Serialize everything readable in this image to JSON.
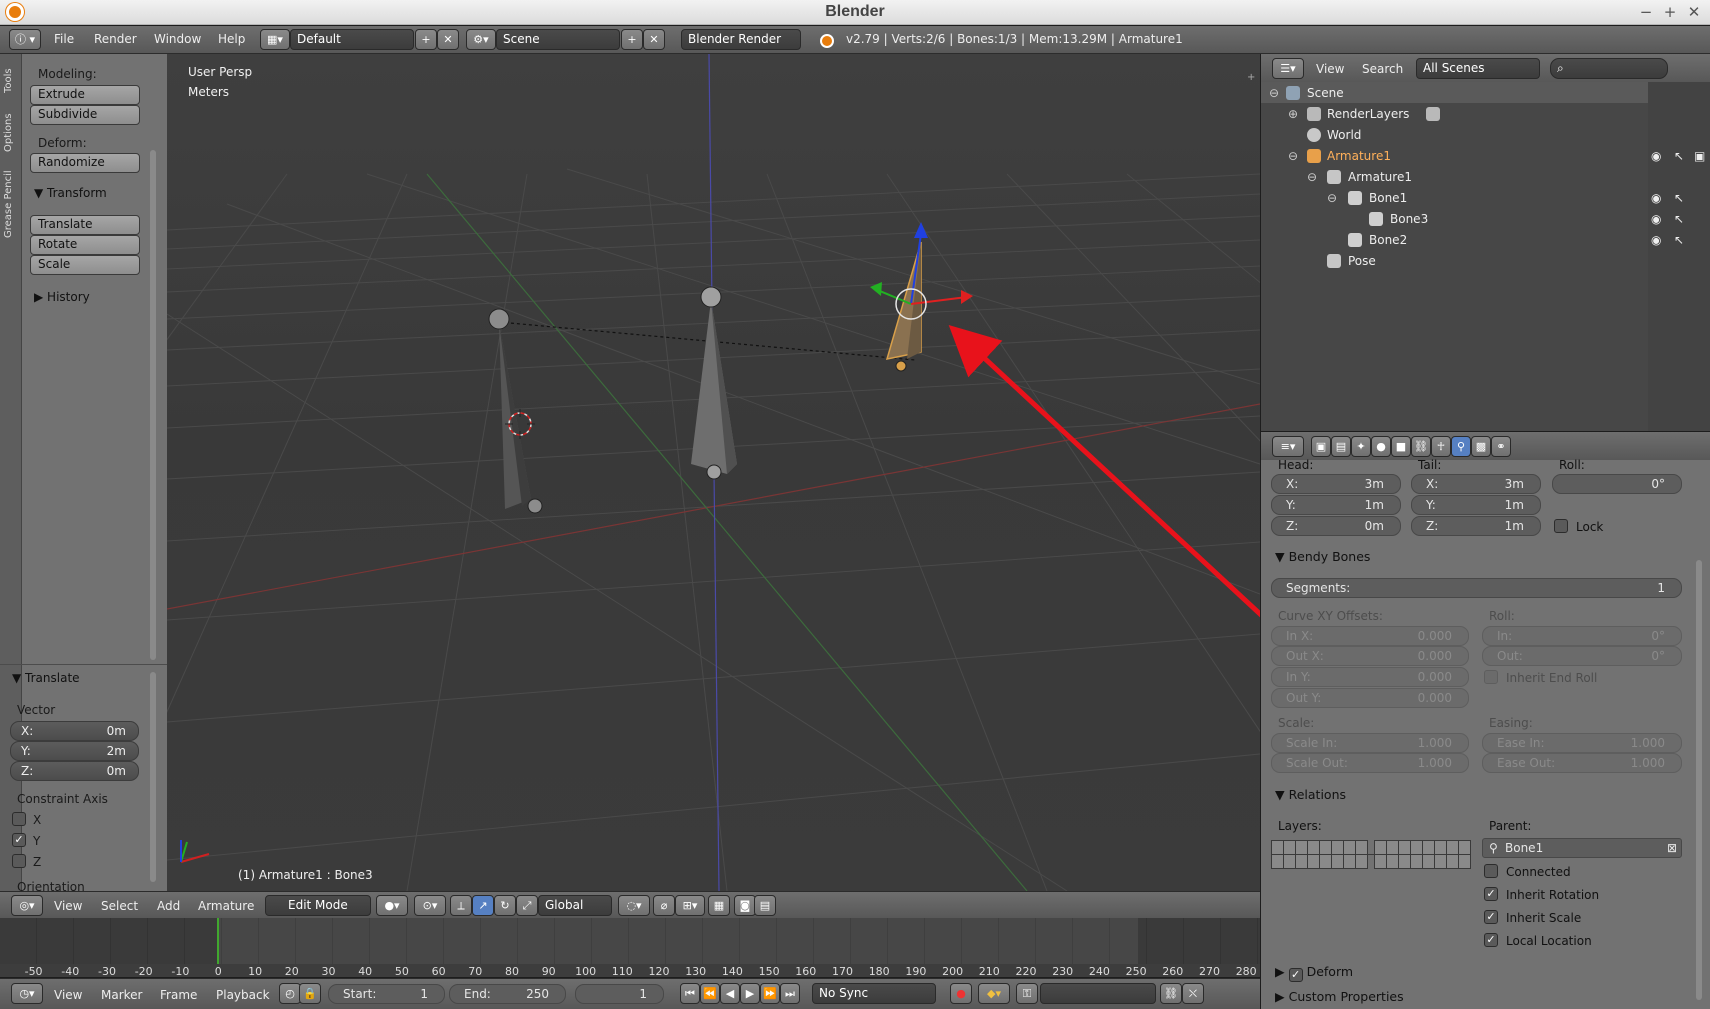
{
  "window": {
    "title": "Blender"
  },
  "menubar": {
    "menus": [
      "File",
      "Render",
      "Window",
      "Help"
    ],
    "layout": "Default",
    "scene": "Scene",
    "engine": "Blender Render",
    "stats": "v2.79 | Verts:2/6 | Bones:1/3 | Mem:13.29M | Armature1"
  },
  "tool_shelf": {
    "tabs": [
      "Tools",
      "Options",
      "Grease Pencil"
    ],
    "modeling_label": "Modeling:",
    "modeling_buttons": [
      "Extrude",
      "Subdivide"
    ],
    "deform_label": "Deform:",
    "deform_buttons": [
      "Randomize"
    ],
    "transform_header": "Transform",
    "transform_buttons": [
      "Translate",
      "Rotate",
      "Scale"
    ],
    "history_header": "History"
  },
  "operator_panel": {
    "header": "Translate",
    "vector_label": "Vector",
    "x_label": "X:",
    "x_value": "0m",
    "y_label": "Y:",
    "y_value": "2m",
    "z_label": "Z:",
    "z_value": "0m",
    "constraint_label": "Constraint Axis",
    "axes": [
      {
        "label": "X",
        "checked": false
      },
      {
        "label": "Y",
        "checked": true
      },
      {
        "label": "Z",
        "checked": false
      }
    ],
    "orientation_label": "Orientation"
  },
  "viewport": {
    "view_name": "User Persp",
    "units": "Meters",
    "status": "(1) Armature1 : Bone3"
  },
  "outliner": {
    "view_menu": "View",
    "search_menu": "Search",
    "filter": "All Scenes",
    "items": [
      "Scene",
      "RenderLayers",
      "World",
      "Armature1",
      "Armature1",
      "Bone1",
      "Bone3",
      "Bone2",
      "Pose"
    ]
  },
  "properties": {
    "head_label": "Head:",
    "tail_label": "Tail:",
    "roll_label": "Roll:",
    "head": {
      "x_label": "X:",
      "x": "3m",
      "y_label": "Y:",
      "y": "1m",
      "z_label": "Z:",
      "z": "0m"
    },
    "tail": {
      "x_label": "X:",
      "x": "3m",
      "y_label": "Y:",
      "y": "1m",
      "z_label": "Z:",
      "z": "1m"
    },
    "roll_value": "0°",
    "lock_label": "Lock",
    "bendy_header": "Bendy Bones",
    "segments_label": "Segments:",
    "segments_value": "1",
    "curve_label": "Curve XY Offsets:",
    "curve_fields": [
      {
        "label": "In X:",
        "value": "0.000"
      },
      {
        "label": "Out X:",
        "value": "0.000"
      },
      {
        "label": "In Y:",
        "value": "0.000"
      },
      {
        "label": "Out Y:",
        "value": "0.000"
      }
    ],
    "bb_roll_label": "Roll:",
    "roll_in_label": "In:",
    "roll_in": "0°",
    "roll_out_label": "Out:",
    "roll_out": "0°",
    "inherit_end_roll": "Inherit End Roll",
    "scale_label": "Scale:",
    "scale_in_label": "Scale In:",
    "scale_in": "1.000",
    "scale_out_label": "Scale Out:",
    "scale_out": "1.000",
    "easing_label": "Easing:",
    "ease_in_label": "Ease In:",
    "ease_in": "1.000",
    "ease_out_label": "Ease Out:",
    "ease_out": "1.000",
    "relations_header": "Relations",
    "layers_label": "Layers:",
    "parent_label": "Parent:",
    "parent_value": "Bone1",
    "connected": "Connected",
    "inherit_rotation": "Inherit Rotation",
    "inherit_scale": "Inherit Scale",
    "local_location": "Local Location",
    "deform_header": "Deform",
    "custom_props_header": "Custom Properties"
  },
  "view3d_header": {
    "menus": [
      "View",
      "Select",
      "Add",
      "Armature"
    ],
    "mode": "Edit Mode",
    "orientation": "Global"
  },
  "timeline": {
    "ticks": [
      "-50",
      "-40",
      "-30",
      "-20",
      "-10",
      "0",
      "10",
      "20",
      "30",
      "40",
      "50",
      "60",
      "70",
      "80",
      "90",
      "100",
      "110",
      "120",
      "130",
      "140",
      "150",
      "160",
      "170",
      "180",
      "190",
      "200",
      "210",
      "220",
      "230",
      "240",
      "250",
      "260",
      "270",
      "280"
    ]
  },
  "timeline_header": {
    "menus": [
      "View",
      "Marker",
      "Frame",
      "Playback"
    ],
    "start_label": "Start:",
    "start": "1",
    "end_label": "End:",
    "end": "250",
    "current": "1",
    "sync": "No Sync"
  },
  "colors": {
    "annotation_arrow": "#e8121b",
    "selected_bone": "#d9a04a",
    "timeline_cursor": "#41a82f"
  }
}
